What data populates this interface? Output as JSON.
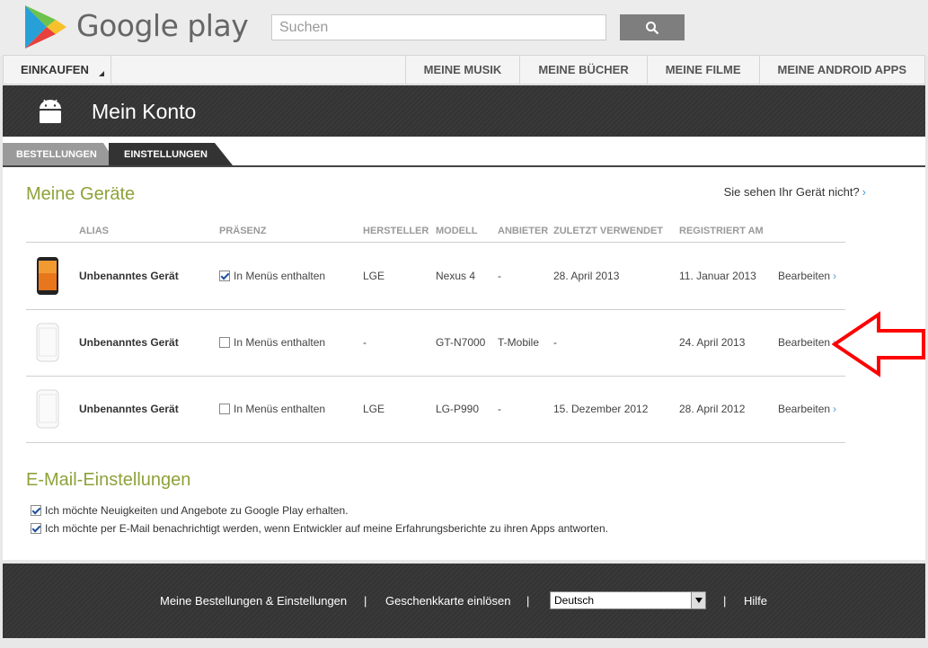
{
  "header": {
    "logo_text": "Google play",
    "search_placeholder": "Suchen"
  },
  "nav": {
    "shop": "EINKAUFEN",
    "items": [
      "MEINE MUSIK",
      "MEINE BÜCHER",
      "MEINE FILME",
      "MEINE ANDROID APPS"
    ]
  },
  "account": {
    "title": "Mein Konto"
  },
  "tabs": {
    "orders": "BESTELLUNGEN",
    "settings": "EINSTELLUNGEN"
  },
  "devices": {
    "title": "Meine Geräte",
    "help_link": "Sie sehen Ihr Gerät nicht?",
    "columns": [
      "ALIAS",
      "PRÄSENZ",
      "HERSTELLER",
      "MODELL",
      "ANBIETER",
      "ZULETZT VERWENDET",
      "REGISTRIERT AM"
    ],
    "rows": [
      {
        "alias": "Unbenanntes Gerät",
        "presence": "In Menüs enthalten",
        "presence_checked": true,
        "manufacturer": "LGE",
        "model": "Nexus 4",
        "carrier": "-",
        "last_used": "28. April 2013",
        "registered": "11. Januar 2013",
        "action": "Bearbeiten"
      },
      {
        "alias": "Unbenanntes Gerät",
        "presence": "In Menüs enthalten",
        "presence_checked": false,
        "manufacturer": "-",
        "model": "GT-N7000",
        "carrier": "T-Mobile",
        "last_used": "-",
        "registered": "24. April 2013",
        "action": "Bearbeiten"
      },
      {
        "alias": "Unbenanntes Gerät",
        "presence": "In Menüs enthalten",
        "presence_checked": false,
        "manufacturer": "LGE",
        "model": "LG-P990",
        "carrier": "-",
        "last_used": "15. Dezember 2012",
        "registered": "28. April 2012",
        "action": "Bearbeiten"
      }
    ]
  },
  "email": {
    "title": "E-Mail-Einstellungen",
    "options": [
      {
        "label": "Ich möchte Neuigkeiten und Angebote zu Google Play erhalten.",
        "checked": true
      },
      {
        "label": "Ich möchte per E-Mail benachrichtigt werden, wenn Entwickler auf meine Erfahrungsberichte zu ihren Apps antworten.",
        "checked": true
      }
    ]
  },
  "footer": {
    "orders_link": "Meine Bestellungen & Einstellungen",
    "giftcard_link": "Geschenkkarte einlösen",
    "separator": "|",
    "language": "Deutsch",
    "help_link": "Hilfe"
  },
  "colors": {
    "accent_green": "#8ea23a",
    "link_blue": "#4a9ed8",
    "annotation_red": "#ff0000"
  }
}
